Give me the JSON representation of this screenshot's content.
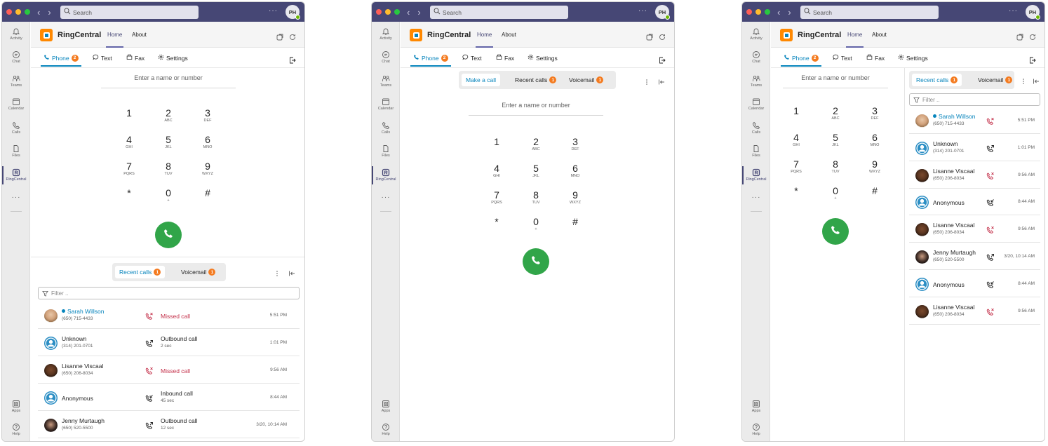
{
  "common": {
    "search_placeholder": "Search",
    "user_initials": "PH",
    "more": "···",
    "rail": {
      "activity": "Activity",
      "chat": "Chat",
      "teams": "Teams",
      "calendar": "Calendar",
      "calls": "Calls",
      "files": "Files",
      "ringcentral": "RingCentral",
      "apps": "Apps",
      "help": "Help"
    },
    "app_name": "RingCentral",
    "tab_home": "Home",
    "tab_about": "About",
    "sub_phone": "Phone",
    "phone_badge": "2",
    "sub_text": "Text",
    "sub_fax": "Fax",
    "sub_settings": "Settings",
    "dial_placeholder": "Enter a name or number",
    "keys": [
      {
        "n": "1",
        "l": ""
      },
      {
        "n": "2",
        "l": "ABC"
      },
      {
        "n": "3",
        "l": "DEF"
      },
      {
        "n": "4",
        "l": "GHI"
      },
      {
        "n": "5",
        "l": "JKL"
      },
      {
        "n": "6",
        "l": "MNO"
      },
      {
        "n": "7",
        "l": "PQRS"
      },
      {
        "n": "8",
        "l": "TUV"
      },
      {
        "n": "9",
        "l": "WXYZ"
      },
      {
        "n": "*",
        "l": ""
      },
      {
        "n": "0",
        "l": "+"
      },
      {
        "n": "#",
        "l": ""
      }
    ],
    "make_call": "Make a call",
    "recent_calls": "Recent calls",
    "recent_badge": "1",
    "voicemail": "Voicemail",
    "voicemail_badge": "1",
    "filter_placeholder": "Filter .."
  },
  "window1_calls": [
    {
      "name": "Sarah Willson",
      "phone": "(650) 715-4433",
      "type": "Missed call",
      "dur": "",
      "time": "5:51 PM"
    },
    {
      "name": "Unknown",
      "phone": "(314) 201-0701",
      "type": "Outbound call",
      "dur": "2 sec",
      "time": "1:01 PM"
    },
    {
      "name": "Lisanne Viscaal",
      "phone": "(650) 206-8034",
      "type": "Missed call",
      "dur": "",
      "time": "9:56 AM"
    },
    {
      "name": "Anonymous",
      "phone": "",
      "type": "Inbound call",
      "dur": "45 sec",
      "time": "8:44 AM"
    },
    {
      "name": "Jenny Murtaugh",
      "phone": "(650) 520-5500",
      "type": "Outbound call",
      "dur": "12 sec",
      "time": "3/20, 10:14 AM"
    }
  ],
  "window3_calls": [
    {
      "name": "Sarah Willson",
      "phone": "(650) 715-4433",
      "time": "5:51 PM"
    },
    {
      "name": "Unknown",
      "phone": "(314) 201-0701",
      "time": "1:01 PM"
    },
    {
      "name": "Lisanne Viscaal",
      "phone": "(650) 206-8034",
      "time": "9:56 AM"
    },
    {
      "name": "Anonymous",
      "phone": "",
      "time": "8:44 AM"
    },
    {
      "name": "Lisanne Viscaal",
      "phone": "(650) 206-8034",
      "time": "9:56 AM"
    },
    {
      "name": "Jenny Murtaugh",
      "phone": "(650) 520-5500",
      "time": "3/20, 10:14 AM"
    },
    {
      "name": "Anonymous",
      "phone": "",
      "time": "8:44 AM"
    },
    {
      "name": "Lisanne Viscaal",
      "phone": "(650) 206-8034",
      "time": "9:56 AM"
    }
  ],
  "colors": {
    "accent": "#0684bc",
    "teams": "#464775",
    "call_green": "#31a549",
    "missed": "#c4314b",
    "badge": "#f47b20"
  }
}
